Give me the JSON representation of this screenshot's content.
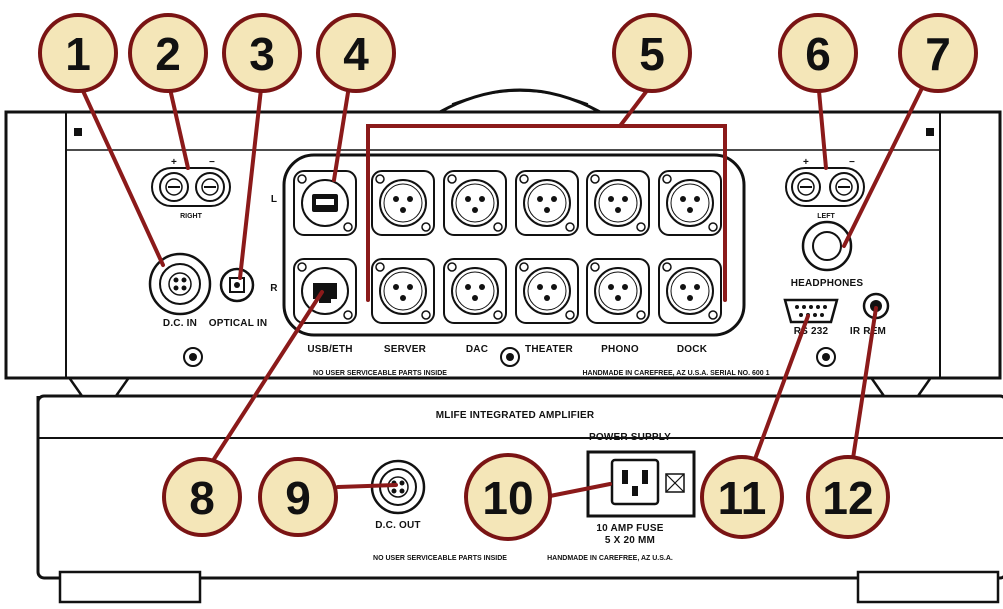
{
  "callouts": [
    "1",
    "2",
    "3",
    "4",
    "5",
    "6",
    "7",
    "8",
    "9",
    "10",
    "11",
    "12"
  ],
  "upper_unit": {
    "right_terminal": {
      "plus": "+",
      "minus": "−",
      "label": "RIGHT"
    },
    "left_terminal": {
      "plus": "+",
      "minus": "−",
      "label": "LEFT"
    },
    "dc_in_label": "D.C. IN",
    "optical_in_label": "OPTICAL IN",
    "row_marker_left": "L",
    "row_marker_right": "R",
    "input_labels": [
      "USB/ETH",
      "SERVER",
      "DAC",
      "THEATER",
      "PHONO",
      "DOCK"
    ],
    "headphones_label": "HEADPHONES",
    "rs232_label": "RS 232",
    "ir_rem_label": "IR REM",
    "notice_left": "NO USER SERVICEABLE PARTS INSIDE",
    "notice_right": "HANDMADE IN CAREFREE, AZ  U.S.A.   SERIAL NO. 600 1"
  },
  "lower_unit": {
    "model_name": "MLIFE INTEGRATED AMPLIFIER",
    "power_supply_label": "POWER SUPPLY",
    "dc_out_label": "D.C. OUT",
    "fuse_line1": "10 AMP FUSE",
    "fuse_line2": "5 X 20 MM",
    "notice_left": "NO USER SERVICEABLE PARTS INSIDE",
    "notice_right": "HANDMADE IN CAREFREE, AZ U.S.A."
  },
  "colors": {
    "callout_fill": "#f4e6b8",
    "callout_ring": "#7a1414",
    "line": "#8b1a1a",
    "outline": "#111111"
  }
}
